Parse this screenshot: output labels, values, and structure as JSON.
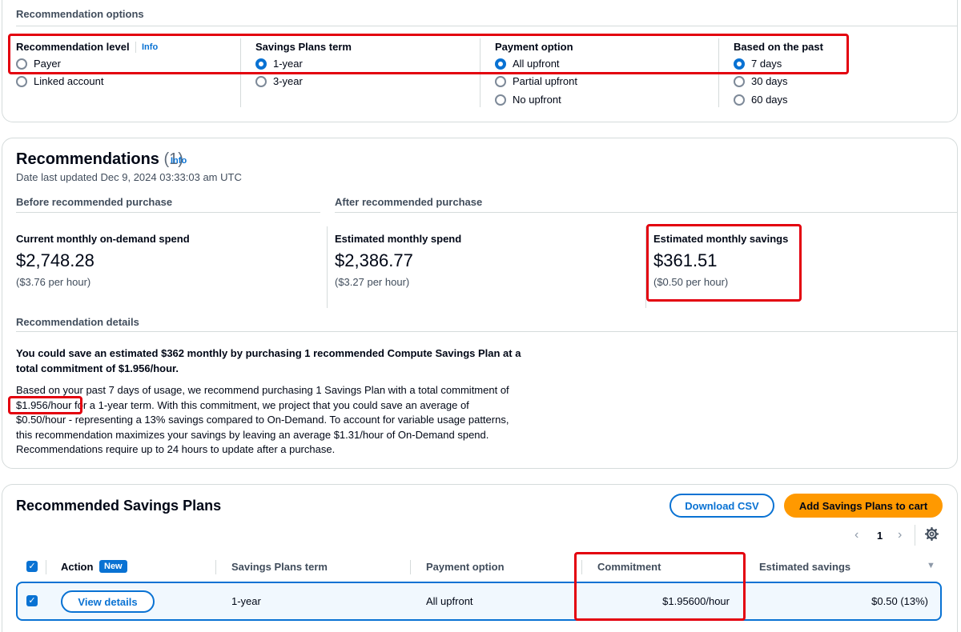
{
  "options": {
    "section_title": "Recommendation options",
    "info": "Info",
    "columns": [
      {
        "title": "Recommendation level",
        "choices": [
          "Payer",
          "Linked account"
        ],
        "selected": 0
      },
      {
        "title": "Savings Plans term",
        "choices": [
          "1-year",
          "3-year"
        ],
        "selected": 0
      },
      {
        "title": "Payment option",
        "choices": [
          "All upfront",
          "Partial upfront",
          "No upfront"
        ],
        "selected": 0
      },
      {
        "title": "Based on the past",
        "choices": [
          "7 days",
          "30 days",
          "60 days"
        ],
        "selected": 0
      }
    ]
  },
  "recs": {
    "title": "Recommendations",
    "count": "(1)",
    "info": "Info",
    "updated": "Date last updated Dec 9, 2024 03:33:03 am UTC",
    "before_label": "Before recommended purchase",
    "after_label": "After recommended purchase",
    "metrics": [
      {
        "label": "Current monthly on-demand spend",
        "value": "$2,748.28",
        "sub": "($3.76 per hour)"
      },
      {
        "label": "Estimated monthly spend",
        "value": "$2,386.77",
        "sub": "($3.27 per hour)"
      },
      {
        "label": "Estimated monthly savings",
        "value": "$361.51",
        "sub": "($0.50 per hour)"
      }
    ],
    "details_label": "Recommendation details",
    "headline_1": "You could save an estimated $362 monthly by purchasing 1 recommended Compute Savings Plan at a",
    "headline_2": "total commitment of $1.956/hour.",
    "body_1": "Based on your past 7 days of usage, we recommend purchasing 1 Savings Plan with a total commitment of",
    "body_2a": "$1.956/hour",
    "body_2b": " for a 1-year term. With this commitment, we project that you could save an average of",
    "body_3": "$0.50/hour - representing a 13% savings compared to On-Demand. To account for variable usage patterns,",
    "body_4": "this recommendation maximizes your savings by leaving an average $1.31/hour of On-Demand spend.",
    "body_5": "Recommendations require up to 24 hours to update after a purchase."
  },
  "plans": {
    "title": "Recommended Savings Plans",
    "download_btn": "Download CSV",
    "add_btn": "Add Savings Plans to cart",
    "page": "1",
    "headers": {
      "action": "Action",
      "new_badge": "New",
      "term": "Savings Plans term",
      "payment": "Payment option",
      "commitment": "Commitment",
      "savings": "Estimated savings"
    },
    "row": {
      "action_btn": "View details",
      "term": "1-year",
      "payment": "All upfront",
      "commitment": "$1.95600/hour",
      "savings": "$0.50 (13%)"
    }
  },
  "colors": {
    "accent": "#0972d3",
    "primary_button": "#ff9900",
    "highlight_box": "#e3000f"
  }
}
